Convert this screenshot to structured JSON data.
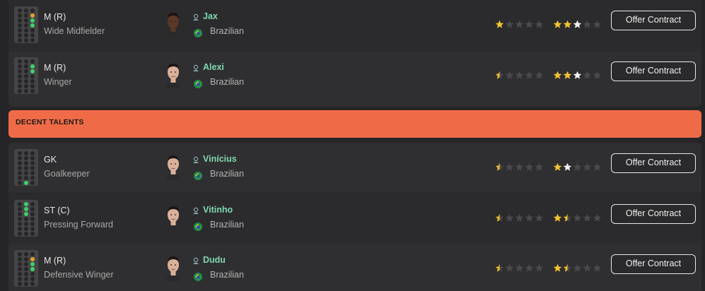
{
  "groups": [
    {
      "rows": [
        {
          "position": "M (R)",
          "role": "Wide Midfielder",
          "name": "Jax",
          "nationality": "Brazilian",
          "current_ability_stars": 1,
          "potential_ability_stars": 3,
          "action_label": "Offer Contract",
          "pitch_highlight": "right-midfield",
          "face_tone": "dark"
        },
        {
          "position": "M (R)",
          "role": "Winger",
          "name": "Alexi",
          "nationality": "Brazilian",
          "current_ability_stars": 0.5,
          "potential_ability_stars": 3,
          "action_label": "Offer Contract",
          "pitch_highlight": "right-wing",
          "face_tone": "light"
        }
      ]
    },
    {
      "title": "DECENT TALENTS",
      "rows": [
        {
          "position": "GK",
          "role": "Goalkeeper",
          "name": "Vinícius",
          "nationality": "Brazilian",
          "current_ability_stars": 0.5,
          "potential_ability_stars": 2,
          "action_label": "Offer Contract",
          "pitch_highlight": "goalkeeper",
          "face_tone": "light"
        },
        {
          "position": "ST (C)",
          "role": "Pressing Forward",
          "name": "Vitinho",
          "nationality": "Brazilian",
          "current_ability_stars": 0.5,
          "potential_ability_stars": 1.5,
          "action_label": "Offer Contract",
          "pitch_highlight": "striker",
          "face_tone": "light"
        },
        {
          "position": "M (R)",
          "role": "Defensive Winger",
          "name": "Dudu",
          "nationality": "Brazilian",
          "current_ability_stars": 0.5,
          "potential_ability_stars": 1.5,
          "action_label": "Offer Contract",
          "pitch_highlight": "right-midfield",
          "face_tone": "light"
        }
      ]
    }
  ],
  "colors": {
    "accent": "#ef6b47",
    "name": "#7fd7b0",
    "star_gold": "#f2c12e",
    "star_white": "#f2f2f2",
    "star_empty": "#4a4a4d",
    "pitch_active": "#3ed06b"
  }
}
